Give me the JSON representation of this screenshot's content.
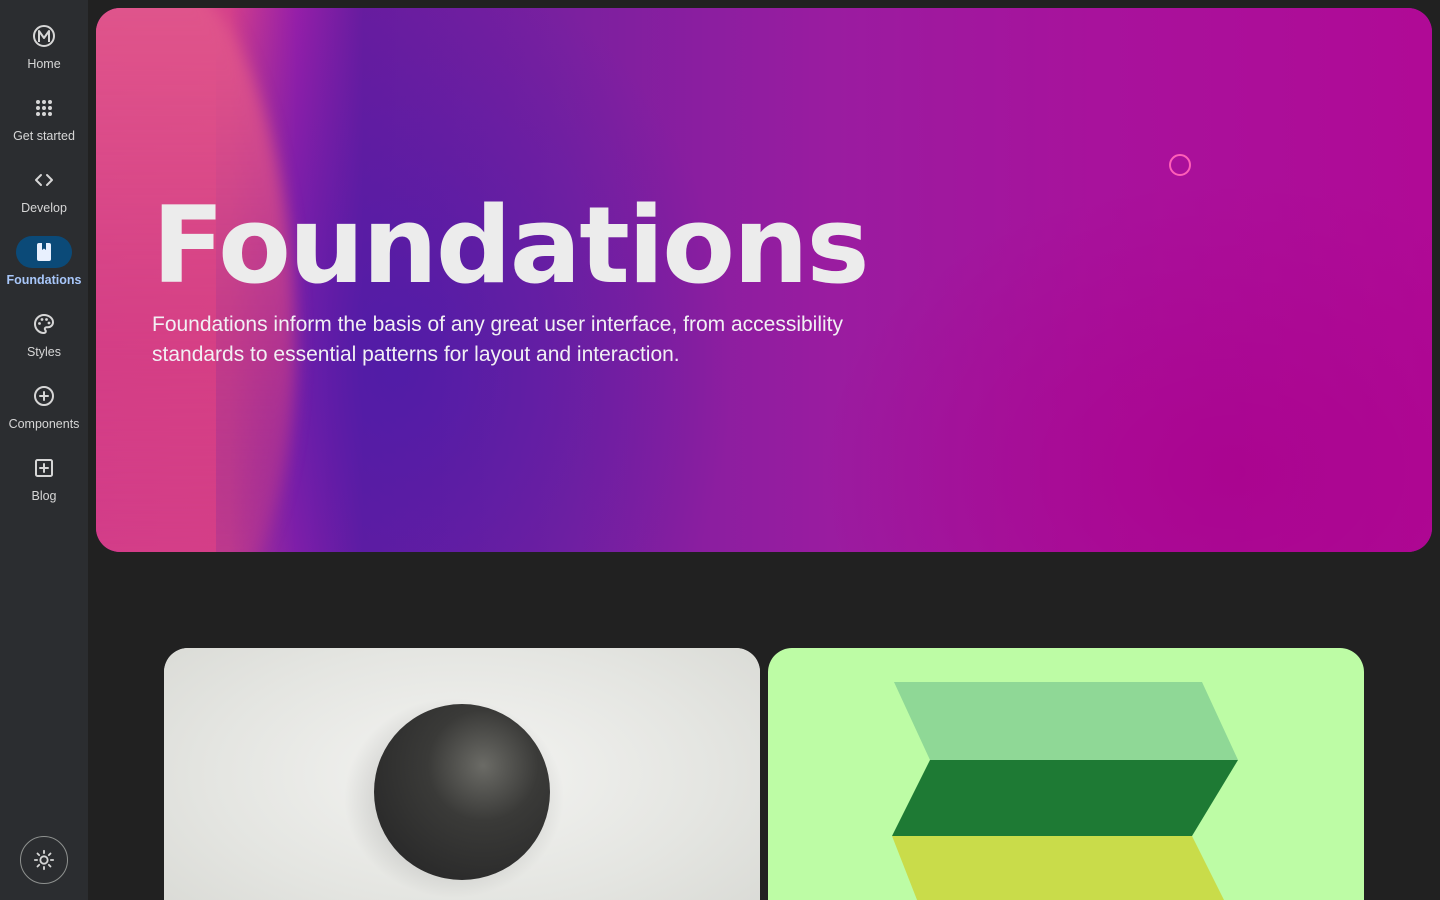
{
  "nav": {
    "items": [
      {
        "label": "Home",
        "icon": "material-logo-icon",
        "active": false
      },
      {
        "label": "Get started",
        "icon": "apps-grid-icon",
        "active": false
      },
      {
        "label": "Develop",
        "icon": "code-icon",
        "active": false
      },
      {
        "label": "Foundations",
        "icon": "bookmark-book-icon",
        "active": true
      },
      {
        "label": "Styles",
        "icon": "palette-icon",
        "active": false
      },
      {
        "label": "Components",
        "icon": "add-circle-icon",
        "active": false
      },
      {
        "label": "Blog",
        "icon": "post-add-icon",
        "active": false
      }
    ],
    "theme_toggle_icon": "light-mode-icon"
  },
  "hero": {
    "title": "Foundations",
    "description": "Foundations inform the basis of any great user interface, from accessibility standards to essential patterns for layout and interaction."
  },
  "colors": {
    "background": "#212121",
    "rail": "#2b2d30",
    "active_pill": "#0b4a78",
    "active_label": "#a8c7fa",
    "card_green": "#bdfca5"
  }
}
